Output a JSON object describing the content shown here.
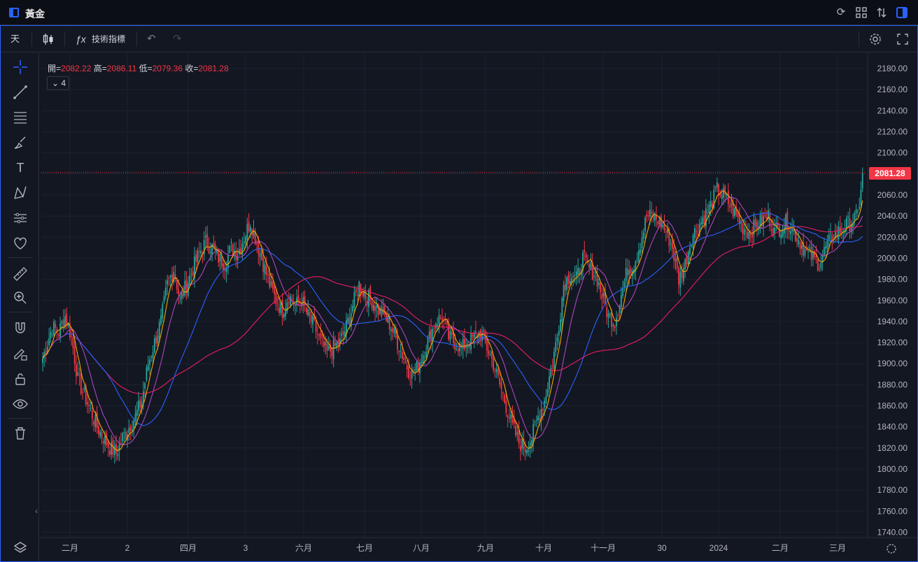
{
  "window": {
    "title": "黃金"
  },
  "toolbar": {
    "interval": "天",
    "indicators_label": "技術指標"
  },
  "legend": {
    "open_label": "開=",
    "open": "2082.22",
    "high_label": "高=",
    "high": "2086.11",
    "low_label": "低=",
    "low": "2079.36",
    "close_label": "收=",
    "close": "2081.28",
    "indicator_count": "4"
  },
  "price_tag": "2081.28",
  "colors": {
    "up": "#26a69a",
    "down": "#f23645",
    "ma1": "#f7a600",
    "ma2": "#ab47bc",
    "ma3": "#2962ff",
    "ma4": "#e91e63",
    "accent": "#2962ff"
  },
  "icons": [
    "crosshair-icon",
    "trend-line-icon",
    "fib-icon",
    "brush-icon",
    "text-icon",
    "pattern-icon",
    "forecast-icon",
    "heart-icon",
    "ruler-icon",
    "zoom-icon",
    "magnet-icon",
    "lock-draw-icon",
    "lock-icon",
    "eye-icon",
    "trash-icon"
  ],
  "chart_data": {
    "type": "candlestick",
    "y_ticks": [
      "2180.00",
      "2160.00",
      "2140.00",
      "2120.00",
      "2100.00",
      "2080.00",
      "2060.00",
      "2040.00",
      "2020.00",
      "2000.00",
      "1980.00",
      "1960.00",
      "1940.00",
      "1920.00",
      "1900.00",
      "1880.00",
      "1860.00",
      "1840.00",
      "1820.00",
      "1800.00",
      "1780.00",
      "1760.00",
      "1740.00"
    ],
    "x_labels": [
      "二月",
      "2",
      "四月",
      "3",
      "六月",
      "七月",
      "八月",
      "九月",
      "十月",
      "十一月",
      "30",
      "2024",
      "二月",
      "三月"
    ],
    "ylim": [
      1735,
      2190
    ],
    "last_price": 2081.28,
    "price_path": [
      [
        0,
        1905
      ],
      [
        6,
        1935
      ],
      [
        10,
        1930
      ],
      [
        14,
        1945
      ],
      [
        18,
        1925
      ],
      [
        22,
        1885
      ],
      [
        26,
        1870
      ],
      [
        30,
        1855
      ],
      [
        34,
        1840
      ],
      [
        38,
        1830
      ],
      [
        42,
        1820
      ],
      [
        46,
        1815
      ],
      [
        50,
        1830
      ],
      [
        54,
        1840
      ],
      [
        58,
        1850
      ],
      [
        62,
        1865
      ],
      [
        66,
        1900
      ],
      [
        70,
        1920
      ],
      [
        74,
        1940
      ],
      [
        78,
        1975
      ],
      [
        82,
        1990
      ],
      [
        86,
        1960
      ],
      [
        90,
        1975
      ],
      [
        94,
        1990
      ],
      [
        98,
        2005
      ],
      [
        102,
        2015
      ],
      [
        106,
        2010
      ],
      [
        110,
        2000
      ],
      [
        114,
        1995
      ],
      [
        118,
        2010
      ],
      [
        122,
        2005
      ],
      [
        126,
        2020
      ],
      [
        130,
        2035
      ],
      [
        134,
        2015
      ],
      [
        138,
        1995
      ],
      [
        142,
        1975
      ],
      [
        146,
        1960
      ],
      [
        150,
        1950
      ],
      [
        154,
        1965
      ],
      [
        158,
        1955
      ],
      [
        162,
        1960
      ],
      [
        166,
        1945
      ],
      [
        170,
        1935
      ],
      [
        174,
        1920
      ],
      [
        178,
        1910
      ],
      [
        182,
        1915
      ],
      [
        186,
        1920
      ],
      [
        190,
        1935
      ],
      [
        194,
        1955
      ],
      [
        198,
        1975
      ],
      [
        202,
        1965
      ],
      [
        206,
        1960
      ],
      [
        210,
        1950
      ],
      [
        214,
        1945
      ],
      [
        218,
        1935
      ],
      [
        222,
        1920
      ],
      [
        226,
        1905
      ],
      [
        230,
        1890
      ],
      [
        234,
        1895
      ],
      [
        238,
        1910
      ],
      [
        242,
        1925
      ],
      [
        246,
        1940
      ],
      [
        250,
        1945
      ],
      [
        254,
        1925
      ],
      [
        258,
        1920
      ],
      [
        262,
        1915
      ],
      [
        266,
        1920
      ],
      [
        270,
        1925
      ],
      [
        274,
        1930
      ],
      [
        278,
        1915
      ],
      [
        282,
        1900
      ],
      [
        286,
        1880
      ],
      [
        290,
        1860
      ],
      [
        294,
        1840
      ],
      [
        298,
        1825
      ],
      [
        302,
        1820
      ],
      [
        306,
        1830
      ],
      [
        310,
        1850
      ],
      [
        314,
        1865
      ],
      [
        318,
        1895
      ],
      [
        322,
        1925
      ],
      [
        326,
        1975
      ],
      [
        330,
        1985
      ],
      [
        334,
        1980
      ],
      [
        338,
        2000
      ],
      [
        342,
        1990
      ],
      [
        346,
        1985
      ],
      [
        350,
        1965
      ],
      [
        354,
        1945
      ],
      [
        358,
        1940
      ],
      [
        362,
        1965
      ],
      [
        366,
        1990
      ],
      [
        370,
        1995
      ],
      [
        374,
        2015
      ],
      [
        378,
        2040
      ],
      [
        382,
        2040
      ],
      [
        386,
        2035
      ],
      [
        390,
        2025
      ],
      [
        394,
        2010
      ],
      [
        398,
        1980
      ],
      [
        402,
        1995
      ],
      [
        406,
        2020
      ],
      [
        410,
        2030
      ],
      [
        414,
        2040
      ],
      [
        418,
        2050
      ],
      [
        422,
        2065
      ],
      [
        426,
        2060
      ],
      [
        430,
        2050
      ],
      [
        434,
        2040
      ],
      [
        438,
        2030
      ],
      [
        442,
        2025
      ],
      [
        446,
        2030
      ],
      [
        450,
        2035
      ],
      [
        454,
        2040
      ],
      [
        458,
        2025
      ],
      [
        462,
        2030
      ],
      [
        466,
        2035
      ],
      [
        470,
        2025
      ],
      [
        474,
        2015
      ],
      [
        478,
        2005
      ],
      [
        482,
        2000
      ],
      [
        486,
        1995
      ],
      [
        490,
        2010
      ],
      [
        494,
        2020
      ],
      [
        498,
        2025
      ],
      [
        502,
        2030
      ],
      [
        506,
        2035
      ],
      [
        510,
        2040
      ],
      [
        513,
        2081.28
      ]
    ]
  }
}
